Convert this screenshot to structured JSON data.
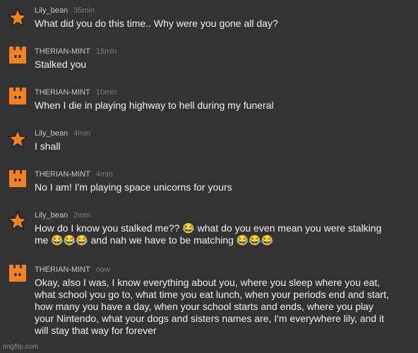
{
  "colors": {
    "background": "#333333",
    "star_avatar": "#f5821f",
    "bot_avatar": "#f5821f"
  },
  "messages": [
    {
      "author": "Lily_bean",
      "time": "35min",
      "avatar": "star-icon",
      "text": "What did you do this time.. Why were you gone all day?"
    },
    {
      "author": "THERIAN-MINT",
      "time": "15min",
      "avatar": "castle-icon",
      "text": "Stalked you"
    },
    {
      "author": "THERIAN-MINT",
      "time": "10min",
      "avatar": "castle-icon",
      "text": "When I die in playing highway to hell during my funeral"
    },
    {
      "author": "Lily_bean",
      "time": "4min",
      "avatar": "star-icon",
      "text": "I shall"
    },
    {
      "author": "THERIAN-MINT",
      "time": "4min",
      "avatar": "castle-icon",
      "text": "No I am! I'm playing space unicorns for yours"
    },
    {
      "author": "Lily_bean",
      "time": "2min",
      "avatar": "star-icon",
      "text": "How do I know you stalked me?? 😂 what do you even mean you were stalking\nme 😂😂😂 and nah we have to be matching 😂😂😂"
    },
    {
      "author": "THERIAN-MINT",
      "time": "now",
      "avatar": "castle-icon",
      "text": "Okay, also I was, I know everything about you, where you sleep where you eat,\nwhat school you go to, what time you eat lunch, when your periods end and start,\nhow many you have a day, when your school starts and ends, where you play\nyour Nintendo, what your dogs and sisters names are, I'm everywhere lily, and it\nwill stay that way for forever"
    }
  ],
  "watermark": "imgflip.com"
}
